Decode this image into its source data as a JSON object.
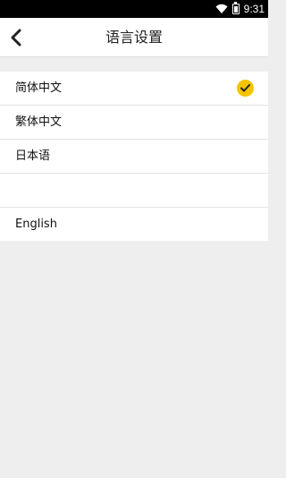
{
  "status_bar": {
    "time": "9:31"
  },
  "header": {
    "title": "语言设置"
  },
  "languages": [
    {
      "label": "简体中文",
      "selected": true
    },
    {
      "label": "繁体中文",
      "selected": false
    },
    {
      "label": "日本语",
      "selected": false
    },
    {
      "label": "",
      "selected": false
    },
    {
      "label": "English",
      "selected": false
    }
  ],
  "colors": {
    "accent": "#f5c400"
  }
}
